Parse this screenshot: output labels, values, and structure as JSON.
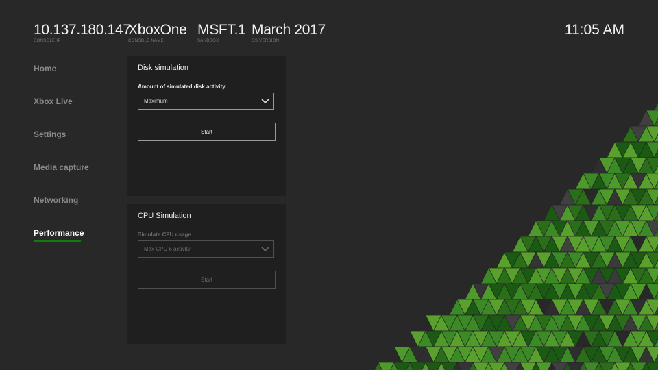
{
  "header": {
    "items": [
      {
        "value": "10.137.180.147",
        "label": "CONSOLE IP"
      },
      {
        "value": "XboxOne",
        "label": "CONSOLE NAME"
      },
      {
        "value": "MSFT.1",
        "label": "SANDBOX"
      },
      {
        "value": "March 2017",
        "label": "OS VERSION"
      }
    ],
    "clock": "11:05 AM"
  },
  "nav": {
    "items": [
      {
        "label": "Home"
      },
      {
        "label": "Xbox Live"
      },
      {
        "label": "Settings"
      },
      {
        "label": "Media capture"
      },
      {
        "label": "Networking"
      },
      {
        "label": "Performance"
      }
    ],
    "active": "Performance"
  },
  "disk_panel": {
    "title": "Disk simulation",
    "field_label": "Amount of simulated disk activity.",
    "selected": "Maximum",
    "button": "Start"
  },
  "cpu_panel": {
    "title": "CPU Simulation",
    "field_label": "Simulate CPU usage",
    "selected": "Max CPU 6 activity",
    "button": "Start",
    "disabled": true
  },
  "colors": {
    "background": "#282828",
    "panel": "#1f1f1f",
    "accent": "#107c10",
    "tile_greens": [
      "#5aa02c",
      "#3c8a26",
      "#2a6e1a",
      "#1a5a12",
      "#4e9a2a"
    ],
    "tile_greys": [
      "#3a3a3a",
      "#343434",
      "#2e2e2e",
      "#404040"
    ]
  }
}
